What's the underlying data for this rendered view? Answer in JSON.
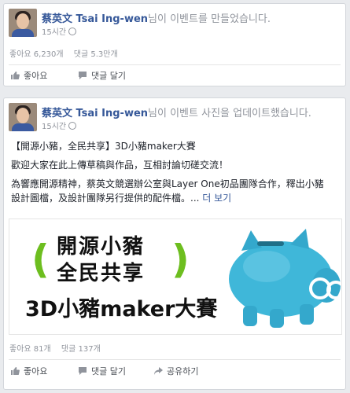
{
  "post1": {
    "author": "蔡英文 Tsai Ing-wen",
    "action_text": "님이 이벤트를 만들었습니다.",
    "time": "15시간",
    "likes": "좋아요 6,230개",
    "comments": "댓글 5.3만개",
    "like_label": "좋아요",
    "comment_label": "댓글 달기"
  },
  "post2": {
    "author": "蔡英文 Tsai Ing-wen",
    "action_text": "님이 이벤트 사진을 업데이트했습니다.",
    "time": "15시간",
    "line1": "【開源小豬，全民共享】3D小豬maker大賽",
    "line2": "歡迎大家在此上傳草稿與作品，互相討論切磋交流！",
    "line3": "為響應開源精神，蔡英文競選辦公室與Layer One初品團隊合作，釋出小豬",
    "line4": "設計圖檔，及設計團隊另行提供的配件檔。...",
    "more": "더 보기",
    "image_text": {
      "l1": "開源小豬",
      "l2": "全民共享",
      "l3": "3D小豬maker大賽"
    },
    "likes": "좋아요 81개",
    "comments": "댓글 137개",
    "like_label": "좋아요",
    "comment_label": "댓글 달기",
    "share_label": "공유하기"
  },
  "colors": {
    "link": "#365899",
    "muted": "#90949c",
    "green": "#6dbe1f",
    "pig": "#3fb7d9"
  }
}
